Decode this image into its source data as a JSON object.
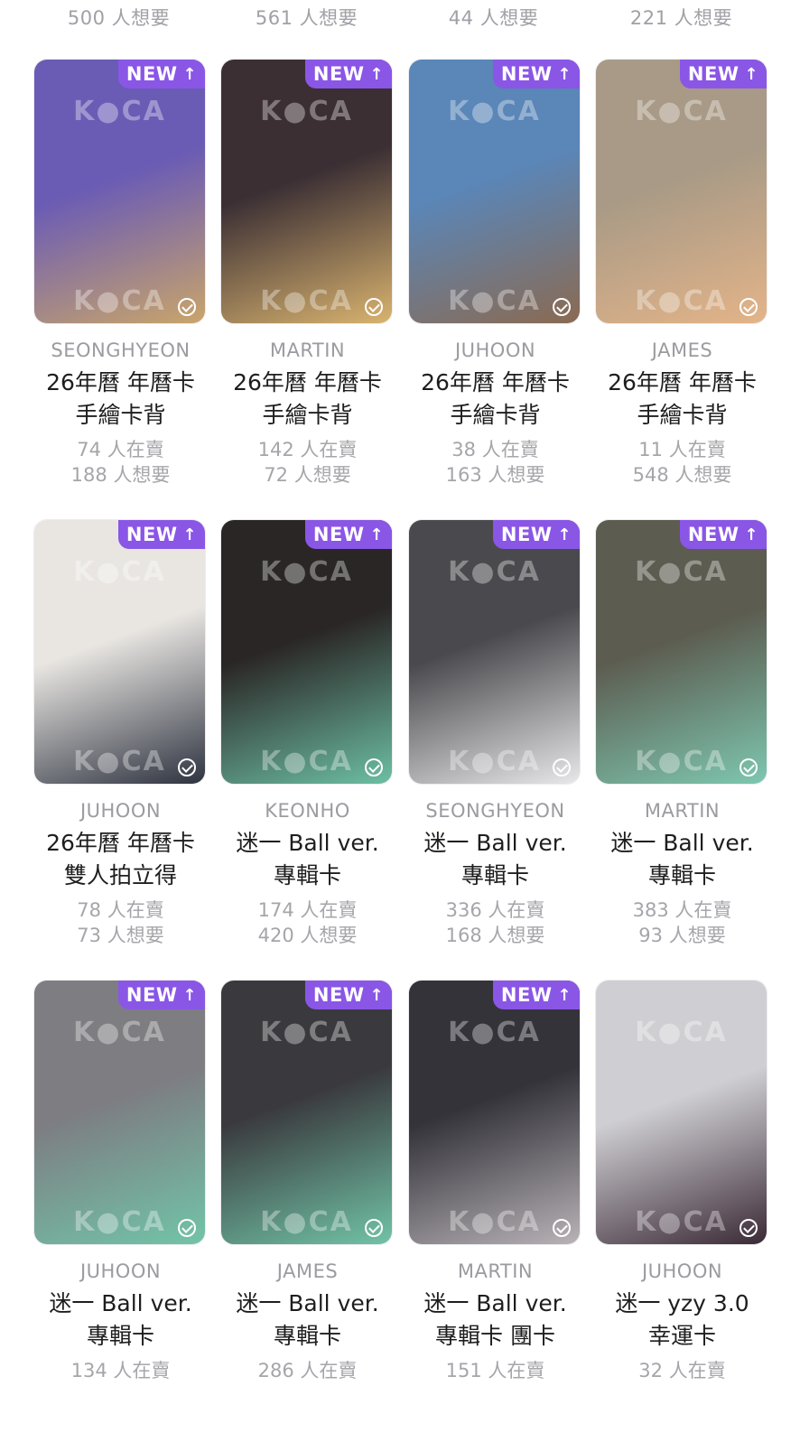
{
  "top_row": [
    "500 人想要",
    "561 人想要",
    "44 人想要",
    "221 人想要"
  ],
  "rows": [
    {
      "cards": [
        {
          "member": "SEONGHYEON",
          "title_line1": "26年曆 年曆卡",
          "title_line2": "手繪卡背",
          "selling": "74 人在賣",
          "wanting": "188 人想要",
          "new": true,
          "badge": "NEW",
          "photo_colors": [
            "#6a5bb5",
            "#c9a56a"
          ]
        },
        {
          "member": "MARTIN",
          "title_line1": "26年曆 年曆卡",
          "title_line2": "手繪卡背",
          "selling": "142 人在賣",
          "wanting": "72 人想要",
          "new": true,
          "badge": "NEW",
          "photo_colors": [
            "#3b2f34",
            "#d9b36f"
          ]
        },
        {
          "member": "JUHOON",
          "title_line1": "26年曆 年曆卡",
          "title_line2": "手繪卡背",
          "selling": "38 人在賣",
          "wanting": "163 人想要",
          "new": true,
          "badge": "NEW",
          "photo_colors": [
            "#5a86b8",
            "#8a6a52"
          ]
        },
        {
          "member": "JAMES",
          "title_line1": "26年曆 年曆卡",
          "title_line2": "手繪卡背",
          "selling": "11 人在賣",
          "wanting": "548 人想要",
          "new": true,
          "badge": "NEW",
          "photo_colors": [
            "#a89a86",
            "#e3b489"
          ]
        }
      ]
    },
    {
      "cards": [
        {
          "member": "JUHOON",
          "title_line1": "26年曆 年曆卡",
          "title_line2": "雙人拍立得",
          "selling": "78 人在賣",
          "wanting": "73 人想要",
          "new": true,
          "badge": "NEW",
          "photo_colors": [
            "#e9e6e2",
            "#2e3340"
          ]
        },
        {
          "member": "KEONHO",
          "title_line1": "迷一 Ball ver.",
          "title_line2": "專輯卡",
          "selling": "174 人在賣",
          "wanting": "420 人想要",
          "new": true,
          "badge": "NEW",
          "photo_colors": [
            "#2a2626",
            "#6dbfa4"
          ]
        },
        {
          "member": "SEONGHYEON",
          "title_line1": "迷一 Ball ver.",
          "title_line2": "專輯卡",
          "selling": "336 人在賣",
          "wanting": "168 人想要",
          "new": true,
          "badge": "NEW",
          "photo_colors": [
            "#4a4a4e",
            "#e8e8ea"
          ]
        },
        {
          "member": "MARTIN",
          "title_line1": "迷一 Ball ver.",
          "title_line2": "專輯卡",
          "selling": "383 人在賣",
          "wanting": "93 人想要",
          "new": true,
          "badge": "NEW",
          "photo_colors": [
            "#5c5c50",
            "#7ec7b0"
          ]
        }
      ]
    },
    {
      "cards": [
        {
          "member": "JUHOON",
          "title_line1": "迷一 Ball ver.",
          "title_line2": "專輯卡",
          "selling": "134 人在賣",
          "wanting": "",
          "new": true,
          "badge": "NEW",
          "photo_colors": [
            "#7d7d82",
            "#72c4a8"
          ]
        },
        {
          "member": "JAMES",
          "title_line1": "迷一 Ball ver.",
          "title_line2": "專輯卡",
          "selling": "286 人在賣",
          "wanting": "",
          "new": true,
          "badge": "NEW",
          "photo_colors": [
            "#3a3a3e",
            "#71c3a6"
          ]
        },
        {
          "member": "MARTIN",
          "title_line1": "迷一 Ball ver.",
          "title_line2": "專輯卡 團卡",
          "selling": "151 人在賣",
          "wanting": "",
          "new": true,
          "badge": "NEW",
          "photo_colors": [
            "#333339",
            "#b9b3b8"
          ]
        },
        {
          "member": "JUHOON",
          "title_line1": "迷一 yzy 3.0",
          "title_line2": "幸運卡",
          "selling": "32 人在賣",
          "wanting": "",
          "new": false,
          "badge": "",
          "photo_colors": [
            "#cfcfd3",
            "#3b2a36"
          ]
        }
      ]
    }
  ],
  "watermark": "K●CA"
}
